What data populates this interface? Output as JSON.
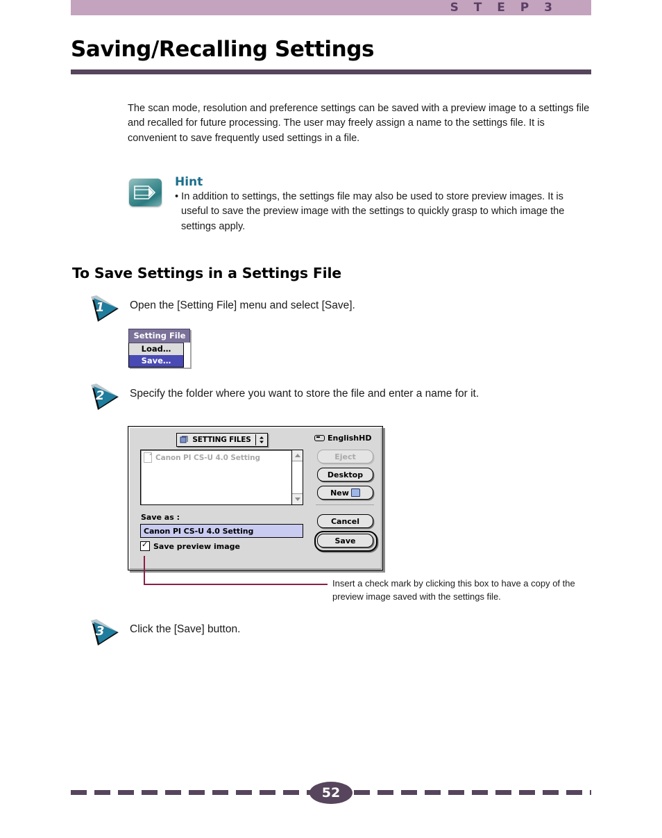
{
  "header": {
    "step_label": "S T E P   3"
  },
  "title": "Saving/Recalling Settings",
  "intro": "The scan mode, resolution and preference settings can be saved with a preview image to a settings file and recalled for future processing. The user may freely assign a name to the settings file. It is convenient to save frequently used settings in a file.",
  "hint": {
    "icon": "pencil-note-icon",
    "title": "Hint",
    "text": "• In addition to settings, the settings file may also be used to store preview images. It is useful to save the preview image with the settings to quickly grasp to which image the settings apply."
  },
  "section_heading": "To Save Settings in a Settings File",
  "steps": [
    {
      "number": "1",
      "text": "Open the [Setting File] menu and select [Save]."
    },
    {
      "number": "2",
      "text": "Specify the folder where you want to store the file and enter a name for it."
    },
    {
      "number": "3",
      "text": "Click the [Save] button."
    }
  ],
  "menu_figure": {
    "title": "Setting File",
    "items": [
      {
        "label": "Load…",
        "selected": false
      },
      {
        "label": "Save…",
        "selected": true
      }
    ]
  },
  "save_dialog": {
    "location_popup": {
      "icon": "folder-stack-icon",
      "label": "SETTING FILES",
      "arrows_icon": "updown-arrows-icon"
    },
    "volume": {
      "icon": "hard-disk-icon",
      "label": "EnglishHD"
    },
    "file_list": [
      {
        "icon": "document-icon",
        "name": "Canon PI CS-U 4.0 Setting"
      }
    ],
    "scrollbar": {
      "up_icon": "scroll-up-arrow-icon",
      "down_icon": "scroll-down-arrow-icon"
    },
    "save_as_label": "Save as :",
    "filename_value": "Canon PI CS-U 4.0 Setting",
    "checkbox": {
      "label": "Save preview image",
      "checked": true,
      "check_glyph": "✓"
    },
    "buttons": {
      "eject": "Eject",
      "desktop": "Desktop",
      "new": "New",
      "new_icon": "new-folder-icon",
      "cancel": "Cancel",
      "save": "Save"
    }
  },
  "callout": {
    "text": "Insert a check mark by clicking this box to have a copy of the preview image saved with the settings file."
  },
  "footer": {
    "page_number": "52"
  },
  "colors": {
    "header_band": "#c3a3bd",
    "step_text": "#5c3f66",
    "rule": "#56455c",
    "hint_title": "#1b6e8c",
    "badge_teal": "#1f7d9e",
    "callout_line": "#8c1c47",
    "menu_highlight": "#4a4ab5",
    "field_highlight": "#c9cbf0"
  }
}
